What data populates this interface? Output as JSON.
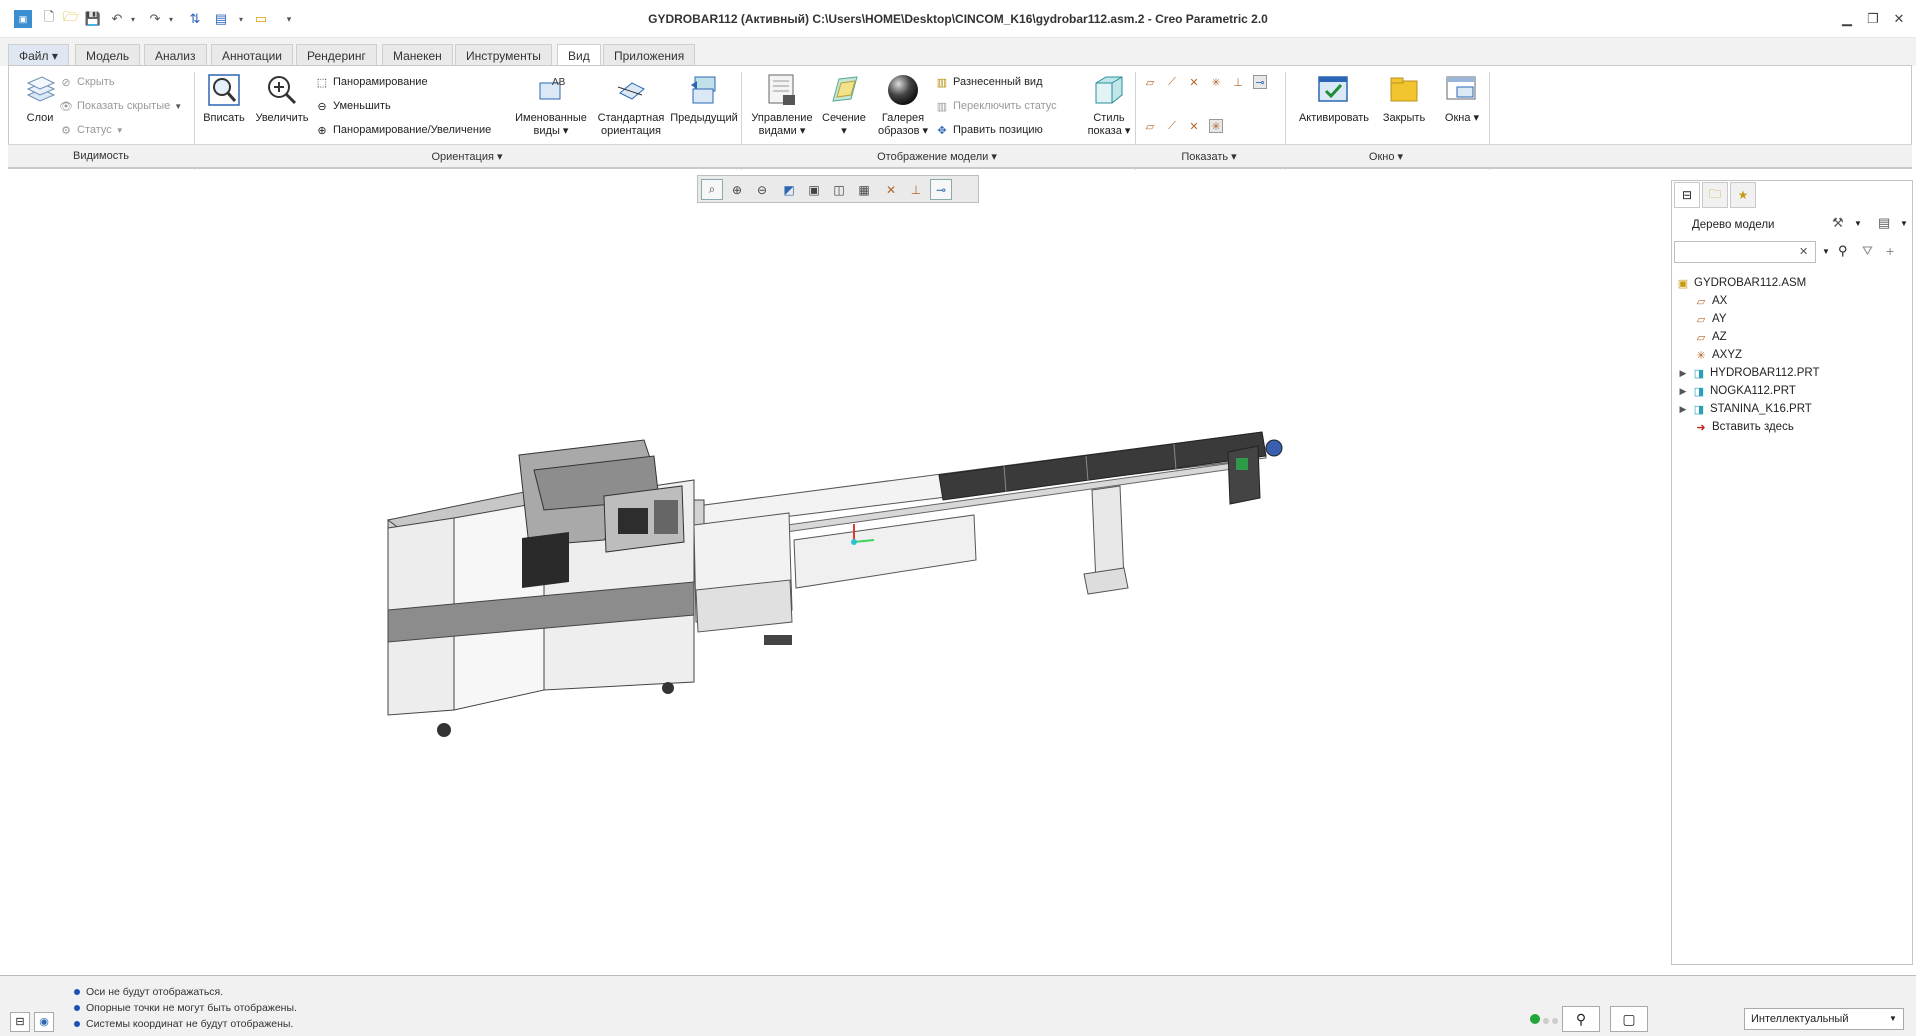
{
  "window": {
    "title": "GYDROBAR112 (Активный) C:\\Users\\HOME\\Desktop\\CINCOM_K16\\gydrobar112.asm.2 - Creo Parametric 2.0"
  },
  "quick_access": {
    "icons": [
      "app-icon",
      "new-icon",
      "open-icon",
      "save-icon",
      "undo-icon",
      "redo-icon",
      "regenerate-icon",
      "windows-icon",
      "close-window-icon",
      "customize-icon"
    ]
  },
  "tabs": [
    {
      "label": "Файл"
    },
    {
      "label": "Модель"
    },
    {
      "label": "Анализ"
    },
    {
      "label": "Аннотации"
    },
    {
      "label": "Рендеринг"
    },
    {
      "label": "Манекен"
    },
    {
      "label": "Инструменты"
    },
    {
      "label": "Вид"
    },
    {
      "label": "Приложения"
    }
  ],
  "ribbon": {
    "visibility": {
      "layers": "Слои",
      "hide": "Скрыть",
      "show_hidden": "Показать скрытые",
      "status": "Статус",
      "group": "Видимость"
    },
    "orientation": {
      "refit": "Вписать",
      "zoom_in": "Увеличить",
      "pan": "Панорамирование",
      "zoom_out": "Уменьшить",
      "pan_zoom": "Панорамирование/Увеличение",
      "group": "Ориентация"
    },
    "model_display": {
      "named_views_1": "Именованные",
      "named_views_2": "виды",
      "std_orient_1": "Стандартная",
      "std_orient_2": "ориентация",
      "previous": "Предыдущий",
      "view_manager_1": "Управление",
      "view_manager_2": "видами",
      "section": "Сечение",
      "gallery_1": "Галерея",
      "gallery_2": "образов",
      "exploded": "Разнесенный вид",
      "toggle_status": "Переключить статус",
      "edit_position": "Править позицию",
      "display_style_1": "Стиль",
      "display_style_2": "показа",
      "group": "Отображение модели"
    },
    "show": {
      "group": "Показать"
    },
    "window": {
      "activate": "Активировать",
      "close": "Закрыть",
      "windows": "Окна",
      "group": "Окно"
    }
  },
  "panel": {
    "title": "Дерево модели",
    "search_placeholder": "",
    "tree": [
      {
        "label": "GYDROBAR112.ASM",
        "icon": "assembly-icon"
      },
      {
        "label": "AX",
        "icon": "datum-plane-icon"
      },
      {
        "label": "AY",
        "icon": "datum-plane-icon"
      },
      {
        "label": "AZ",
        "icon": "datum-plane-icon"
      },
      {
        "label": "AXYZ",
        "icon": "csys-icon"
      },
      {
        "label": "HYDROBAR112.PRT",
        "icon": "part-icon"
      },
      {
        "label": "NOGKA112.PRT",
        "icon": "part-icon"
      },
      {
        "label": "STANINA_K16.PRT",
        "icon": "part-icon"
      },
      {
        "label": "Вставить здесь",
        "icon": "insert-arrow-icon"
      }
    ]
  },
  "status": {
    "messages": [
      "Оси не будут отображаться.",
      "Опорные точки не могут быть отображены.",
      "Системы координат не будут отображены."
    ],
    "filter_value": "Интеллектуальный"
  },
  "colors": {
    "accent_blue": "#1f4fb8",
    "status_green": "#22a83a",
    "folder_yellow": "#f2c530"
  }
}
